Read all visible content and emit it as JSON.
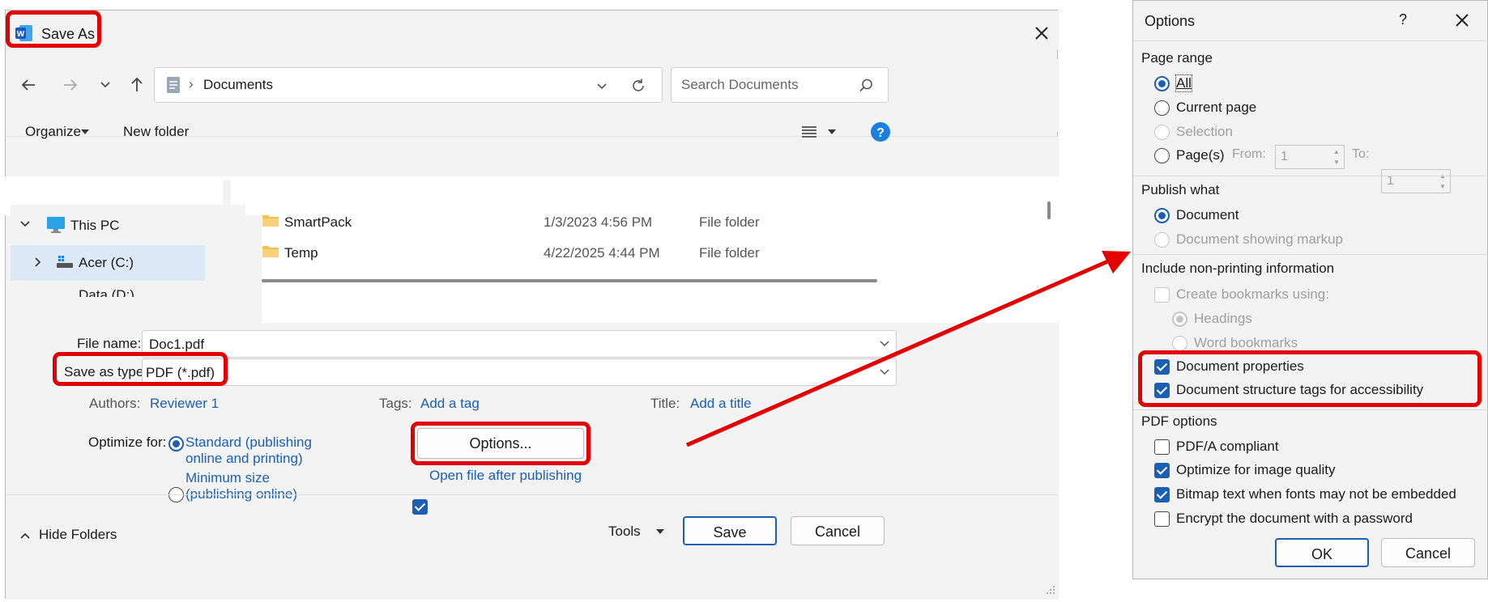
{
  "save_as": {
    "title": "Save As",
    "nav": {
      "location": "Documents",
      "search_placeholder": "Search Documents"
    },
    "toolbar": {
      "organize": "Organize",
      "new_folder": "New folder"
    },
    "tree": {
      "this_pc": "This PC",
      "drive_c": "Acer (C:)",
      "drive_d": "Data (D:)"
    },
    "files": [
      {
        "name": "SmartPack",
        "date": "1/3/2023 4:56 PM",
        "type": "File folder"
      },
      {
        "name": "Temp",
        "date": "4/22/2025 4:44 PM",
        "type": "File folder"
      }
    ],
    "form": {
      "file_name_label": "File name:",
      "file_name": "Doc1.pdf",
      "save_type_label": "Save as type:",
      "save_type": "PDF (*.pdf)",
      "authors_label": "Authors:",
      "authors": "Reviewer 1",
      "tags_label": "Tags:",
      "tags": "Add a tag",
      "title_label": "Title:",
      "title_value": "Add a title",
      "optimize_label": "Optimize for:",
      "standard_1": "Standard (publishing",
      "standard_2": "online and printing)",
      "minimum_1": "Minimum size",
      "minimum_2": "(publishing online)",
      "options_button": "Options...",
      "open_after": "Open file after publishing"
    },
    "footer": {
      "hide_folders": "Hide Folders",
      "tools": "Tools",
      "save": "Save",
      "cancel": "Cancel"
    }
  },
  "options": {
    "title": "Options",
    "help": "?",
    "page_range": {
      "heading": "Page range",
      "all": "All",
      "current": "Current page",
      "selection": "Selection",
      "pages": "Page(s)",
      "from_label": "From:",
      "from_value": "1",
      "to_label": "To:",
      "to_value": "1"
    },
    "publish_what": {
      "heading": "Publish what",
      "document": "Document",
      "markup": "Document showing markup"
    },
    "non_printing": {
      "heading": "Include non-printing information",
      "bookmarks": "Create bookmarks using:",
      "headings": "Headings",
      "word_bookmarks": "Word bookmarks",
      "properties": "Document properties",
      "structure_tags": "Document structure tags for accessibility"
    },
    "pdf_options": {
      "heading": "PDF options",
      "pdfa": "PDF/A compliant",
      "image_quality": "Optimize for image quality",
      "bitmap": "Bitmap text when fonts may not be embedded",
      "encrypt": "Encrypt the document with a password"
    },
    "ok": "OK",
    "cancel": "Cancel"
  },
  "colors": {
    "highlight": "#e40000",
    "accent": "#1a5fb4",
    "folder": "#f2c14e"
  }
}
